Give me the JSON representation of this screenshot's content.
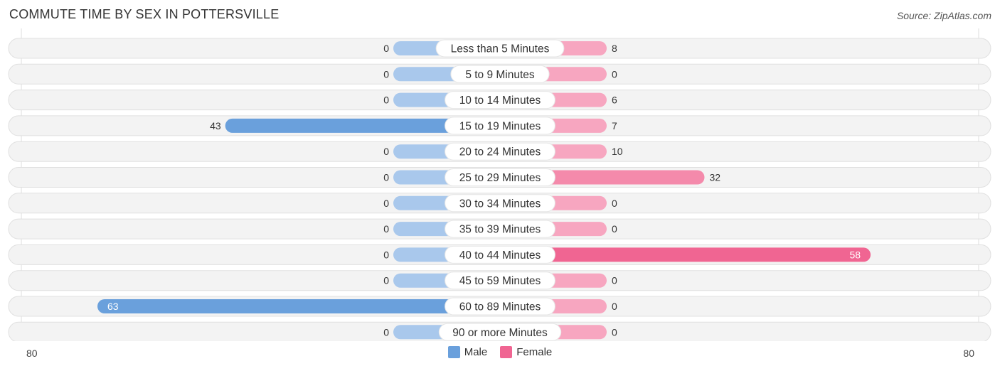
{
  "title": "COMMUTE TIME BY SEX IN POTTERSVILLE",
  "source": "Source: ZipAtlas.com",
  "axis": {
    "left_label": "80",
    "right_label": "80"
  },
  "legend": [
    {
      "label": "Male",
      "color": "#6aa0dc"
    },
    {
      "label": "Female",
      "color": "#f06592"
    }
  ],
  "colors": {
    "male_strong": "#6aa0dc",
    "male_light": "#a9c8ec",
    "female_strong": "#f06592",
    "female_light": "#f7a6c0",
    "row_bg": "#f3f3f3"
  },
  "chart_data": {
    "type": "bar",
    "orientation": "horizontal-diverging",
    "title": "COMMUTE TIME BY SEX IN POTTERSVILLE",
    "xlim": [
      -80,
      80
    ],
    "categories": [
      "Less than 5 Minutes",
      "5 to 9 Minutes",
      "10 to 14 Minutes",
      "15 to 19 Minutes",
      "20 to 24 Minutes",
      "25 to 29 Minutes",
      "30 to 34 Minutes",
      "35 to 39 Minutes",
      "40 to 44 Minutes",
      "45 to 59 Minutes",
      "60 to 89 Minutes",
      "90 or more Minutes"
    ],
    "series": [
      {
        "name": "Male",
        "values": [
          0,
          0,
          0,
          43,
          0,
          0,
          0,
          0,
          0,
          0,
          63,
          0
        ]
      },
      {
        "name": "Female",
        "values": [
          8,
          0,
          6,
          7,
          10,
          32,
          0,
          0,
          58,
          0,
          0,
          0
        ]
      }
    ],
    "legend_position": "bottom-center"
  }
}
